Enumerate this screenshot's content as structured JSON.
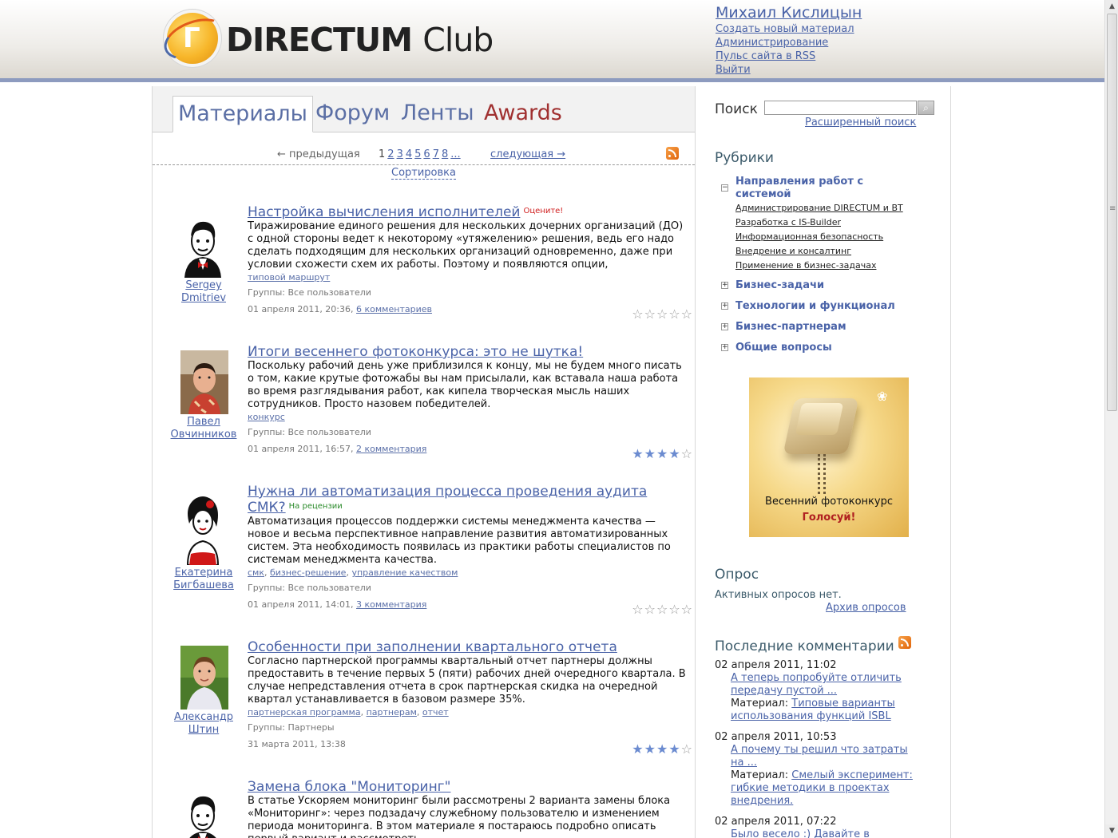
{
  "header": {
    "logo_text": "DIRECTUM",
    "logo_club": "Club",
    "user_name": "Михаил Кислицын",
    "links": [
      "Создать новый материал",
      "Администрирование",
      "Пульс сайта в RSS",
      "Выйти"
    ]
  },
  "tabs": [
    "Материалы",
    "Форум",
    "Ленты",
    "Awards"
  ],
  "pager": {
    "prev": "← предыдущая",
    "current": "1",
    "pages": [
      "2",
      "3",
      "4",
      "5",
      "6",
      "7",
      "8",
      "..."
    ],
    "next": "следующая →",
    "sort": "Сортировка"
  },
  "posts": [
    {
      "title": "Настройка вычисления исполнителей",
      "flag": "Оцените!",
      "text": "Тиражирование единого решения для нескольких дочерних организаций (ДО) с одной стороны ведет к некоторому «утяжелению» решения, ведь его надо сделать подходящим для нескольких организаций одновременно, даже при условии схожести схем их работы. Поэтому и появляются опции,",
      "tags": [
        "типовой маршрут"
      ],
      "groups": "Группы: Все пользователи",
      "date": "01 апреля 2011, 20:36,",
      "comments": "6 комментариев",
      "author1": "Sergey",
      "author2": "Dmitriev",
      "rating": 0
    },
    {
      "title": "Итоги весеннего фотоконкурса: это не шутка!",
      "flag": "",
      "text": "Поскольку рабочий день уже приблизился к концу, мы не будем много писать о том, какие крутые фотожабы вы нам присылали, как вставала наша работа во время разглядывания работ, как кипела творческая мысль наших сотрудников. Просто назовем победителей.",
      "tags": [
        "конкурс"
      ],
      "groups": "Группы: Все пользователи",
      "date": "01 апреля 2011, 16:57,",
      "comments": "2 комментария",
      "author1": "Павел",
      "author2": "Овчинников",
      "rating": 4
    },
    {
      "title": "Нужна ли автоматизация процесса проведения аудита СМК?",
      "flag": "На рецензии",
      "text": "Автоматизация процессов поддержки системы менеджмента качества — новое и весьма перспективное направление развития автоматизированных систем. Эта необходимость появилась из практики работы специалистов по системам менеджмента качества.",
      "tags": [
        "смк",
        "бизнес-решение",
        "управление качеством"
      ],
      "groups": "Группы: Все пользователи",
      "date": "01 апреля 2011, 14:01,",
      "comments": "3 комментария",
      "author1": "Екатерина",
      "author2": "Бигбашева",
      "rating": 0
    },
    {
      "title": "Особенности при заполнении квартального отчета",
      "flag": "",
      "text": "Согласно партнерской программы квартальный отчет партнеры должны предоставить в течение первых 5 (пяти) рабочих дней очередного квартала. В случае непредставления отчета в срок партнерская скидка на очередной квартал устанавливается в базовом размере 35%.",
      "tags": [
        "партнерская программа",
        "партнерам",
        "отчет"
      ],
      "groups": "Группы: Партнеры",
      "date": "31 марта 2011, 13:38",
      "comments": "",
      "author1": "Александр",
      "author2": "Штин",
      "rating": 4
    },
    {
      "title": "Замена блока \"Мониторинг\"",
      "flag": "",
      "text": "В статье Ускоряем мониторинг были рассмотрены 2 варианта замены блока «Мониторинг»: через подзадачу служебному пользователю и изменением периода мониторинга. В этом материале я постараюсь подробно описать первый вариант и рассмотреть",
      "tags": [],
      "groups": "",
      "date": "",
      "comments": "",
      "author1": "",
      "author2": "",
      "rating": 0
    }
  ],
  "sidebar": {
    "search_label": "Поиск",
    "search_value": "",
    "advanced_search": "Расширенный поиск",
    "rubrics_title": "Рубрики",
    "categories": [
      {
        "label": "Направления работ с",
        "label2": "системой",
        "expanded": true,
        "sub": [
          "Администрирование DIRECTUM и ВТ",
          "Разработка с IS-Builder",
          "Информационная безопасность",
          "Внедрение и консалтинг",
          "Применение в бизнес-задачах"
        ]
      },
      {
        "label": "Бизнес-задачи",
        "expanded": false
      },
      {
        "label": "Технологии и функционал",
        "expanded": false
      },
      {
        "label": "Бизнес-партнерам",
        "expanded": false
      },
      {
        "label": "Общие вопросы",
        "expanded": false
      }
    ],
    "banner_text": "Весенний фотоконкурс",
    "banner_cta": "Голосуй!",
    "poll_title": "Опрос",
    "poll_text": "Активных опросов нет.",
    "poll_archive": "Архив опросов",
    "comments_title": "Последние комментарии",
    "comments": [
      {
        "date": "02 апреля 2011, 11:02",
        "link1": "А теперь попробуйте отличить",
        "link2": "передачу пустой ...",
        "material_label": "Материал:",
        "material1": "Типовые варианты",
        "material2": "использования функций ISBL",
        "material3": ""
      },
      {
        "date": "02 апреля 2011, 10:53",
        "link1": "А почему ты решил что затраты",
        "link2": "на ...",
        "material_label": "Материал:",
        "material1": "Смелый эксперимент:",
        "material2": "гибкие методики в проектах",
        "material3": "внедрения."
      },
      {
        "date": "02 апреля 2011, 07:22",
        "link1": "Было весело :) Давайте в",
        "link2": "",
        "material_label": "",
        "material1": "",
        "material2": "",
        "material3": ""
      }
    ]
  },
  "colors": {
    "link": "#4a63a8",
    "header_border": "#8d9bbf",
    "awards_tab": "#a03030",
    "flag_red": "#d02020",
    "flag_green": "#2a8a2a",
    "banner_cta": "#b02020"
  }
}
